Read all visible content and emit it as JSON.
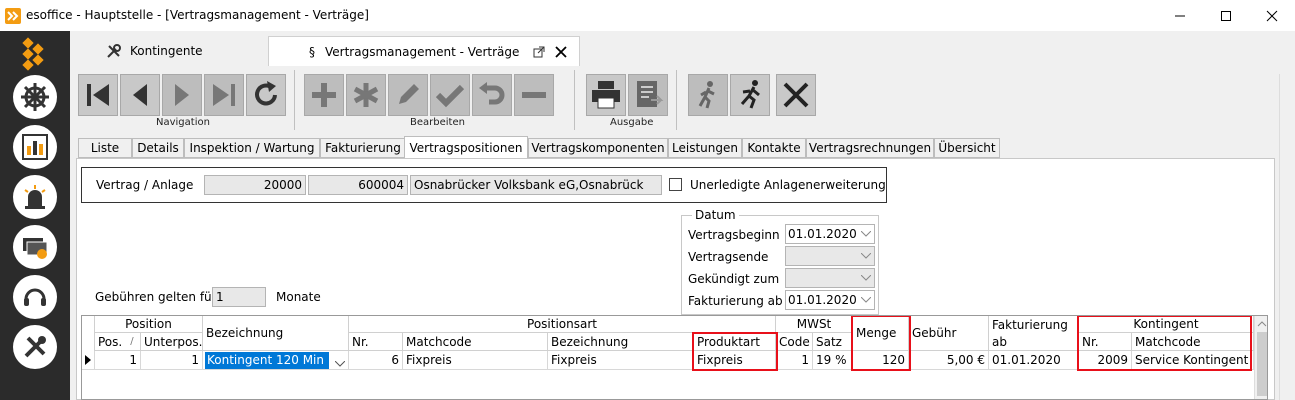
{
  "window": {
    "title": "esoffice - Hauptstelle - [Vertragsmanagement - Verträge]"
  },
  "colors": {
    "sidebar": "#2b2b2b",
    "accent_orange": "#f39c12",
    "highlight": "#e8101a",
    "selection": "#0078d7"
  },
  "top_tabs": [
    {
      "label": "Kontingente",
      "icon": "wrench-icon"
    },
    {
      "label": "Vertragsmanagement - Verträge",
      "icon": "paragraph-icon"
    }
  ],
  "toolbar": {
    "groups": [
      {
        "label": "Navigation"
      },
      {
        "label": "Bearbeiten"
      },
      {
        "label": "Ausgabe"
      }
    ]
  },
  "sub_tabs": [
    "Liste",
    "Details",
    "Inspektion / Wartung",
    "Fakturierung",
    "Vertragspositionen",
    "Vertragskomponenten",
    "Leistungen",
    "Kontakte",
    "Vertragsrechnungen",
    "Übersicht"
  ],
  "vertrag": {
    "label": "Vertrag / Anlage",
    "nr": "20000",
    "anlage": "600004",
    "name": "Osnabrücker Volksbank eG,Osnabrück",
    "checkbox_label": "Unerledigte Anlagenerweiterung"
  },
  "datum": {
    "title": "Datum",
    "rows": [
      {
        "label": "Vertragsbeginn",
        "value": "01.01.2020"
      },
      {
        "label": "Vertragsende",
        "value": ""
      },
      {
        "label": "Gekündigt zum",
        "value": ""
      },
      {
        "label": "Fakturierung ab",
        "value": "01.01.2020"
      }
    ]
  },
  "gebuehren": {
    "label": "Gebühren gelten für",
    "value": "1",
    "unit": "Monate"
  },
  "grid": {
    "groups": {
      "position": "Position",
      "positionsart": "Positionsart",
      "mwst": "MWSt",
      "kontingent": "Kontingent"
    },
    "headers": {
      "pos": "Pos.",
      "sort": "/",
      "unterpos": "Unterpos.",
      "bezeichnung": "Bezeichnung",
      "pa_nr": "Nr.",
      "pa_matchcode": "Matchcode",
      "pa_bezeichnung": "Bezeichnung",
      "produktart": "Produktart",
      "code": "Code",
      "satz": "Satz",
      "menge": "Menge",
      "gebuehr": "Gebühr",
      "fakt1": "Fakturierung",
      "fakt2": "ab",
      "k_nr": "Nr.",
      "k_matchcode": "Matchcode"
    },
    "row": {
      "pos": "1",
      "unterpos": "1",
      "bezeichnung": "Kontingent 120 Min",
      "pa_nr": "6",
      "pa_matchcode": "Fixpreis",
      "pa_bezeichnung": "Fixpreis",
      "produktart": "Fixpreis",
      "code": "1",
      "satz": "19 %",
      "menge": "120",
      "gebuehr": "5,00 €",
      "fakturierung_ab": "01.01.2020",
      "k_nr": "2009",
      "k_matchcode": "Service Kontingent"
    }
  }
}
